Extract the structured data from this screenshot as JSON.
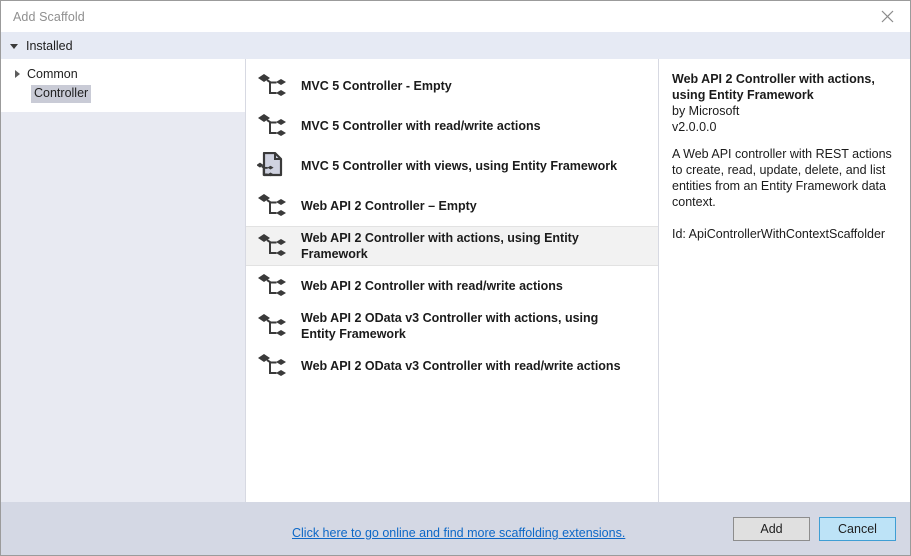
{
  "window": {
    "title": "Add Scaffold",
    "close_icon": "close-icon"
  },
  "installed_bar": {
    "label": "Installed",
    "expander_icon": "triangle-down-icon"
  },
  "tree": {
    "root": {
      "label": "Common",
      "expander_icon": "triangle-right-icon"
    },
    "child": {
      "label": "Controller",
      "selected": true
    }
  },
  "list": {
    "items": [
      {
        "label": "MVC 5 Controller - Empty",
        "icon": "controller-icon",
        "selected": false
      },
      {
        "label": "MVC 5 Controller with read/write actions",
        "icon": "controller-icon",
        "selected": false
      },
      {
        "label": "MVC 5 Controller with views, using Entity Framework",
        "icon": "controller-with-views-icon",
        "selected": false
      },
      {
        "label": "Web API 2 Controller – Empty",
        "icon": "controller-icon",
        "selected": false
      },
      {
        "label": "Web API 2 Controller with actions, using Entity Framework",
        "icon": "controller-icon",
        "selected": true
      },
      {
        "label": "Web API 2 Controller with read/write actions",
        "icon": "controller-icon",
        "selected": false
      },
      {
        "label": "Web API 2 OData v3 Controller with actions, using Entity Framework",
        "icon": "controller-icon",
        "selected": false
      },
      {
        "label": "Web API 2 OData v3 Controller with read/write actions",
        "icon": "controller-icon",
        "selected": false
      }
    ],
    "extensions_link": "Click here to go online and find more scaffolding extensions."
  },
  "details": {
    "title": "Web API 2 Controller with actions, using Entity Framework",
    "author": "by Microsoft",
    "version": "v2.0.0.0",
    "description": "A Web API controller with REST actions to create, read, update, delete, and list entities from an Entity Framework data context.",
    "id_line": "Id: ApiControllerWithContextScaffolder"
  },
  "footer": {
    "add_label": "Add",
    "cancel_label": "Cancel"
  },
  "colors": {
    "dialog_bg": "#e8eaf2",
    "footer_bg": "#d4d8e4",
    "installed_bar_bg": "#e6eaf4",
    "link": "#0d68c7",
    "selection_gray": "#c9cbd6",
    "hover_blue": "#bde3f7"
  }
}
